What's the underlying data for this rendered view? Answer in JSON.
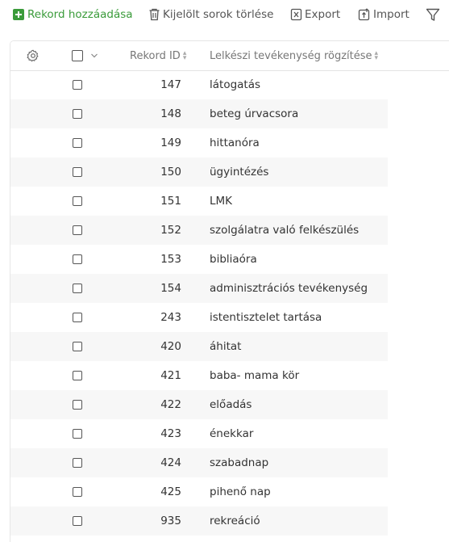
{
  "toolbar": {
    "add_label": "Rekord hozzáadása",
    "delete_label": "Kijelölt sorok törlése",
    "export_label": "Export",
    "import_label": "Import"
  },
  "table": {
    "columns": {
      "id": "Rekord ID",
      "name": "Lelkészi tevékenység rögzítése"
    },
    "rows": [
      {
        "id": "147",
        "name": "látogatás"
      },
      {
        "id": "148",
        "name": "beteg úrvacsora"
      },
      {
        "id": "149",
        "name": "hittanóra"
      },
      {
        "id": "150",
        "name": "ügyintézés"
      },
      {
        "id": "151",
        "name": "LMK"
      },
      {
        "id": "152",
        "name": "szolgálatra való felkészülés"
      },
      {
        "id": "153",
        "name": "bibliaóra"
      },
      {
        "id": "154",
        "name": "adminisztrációs tevékenység"
      },
      {
        "id": "243",
        "name": "istentisztelet tartása"
      },
      {
        "id": "420",
        "name": "áhitat"
      },
      {
        "id": "421",
        "name": "baba- mama kör"
      },
      {
        "id": "422",
        "name": "előadás"
      },
      {
        "id": "423",
        "name": "énekkar"
      },
      {
        "id": "424",
        "name": "szabadnap"
      },
      {
        "id": "425",
        "name": "pihenő nap"
      },
      {
        "id": "935",
        "name": "rekreáció"
      }
    ]
  },
  "colors": {
    "accent_green": "#3a9b3a",
    "row_stripe": "#f7f7f7"
  }
}
